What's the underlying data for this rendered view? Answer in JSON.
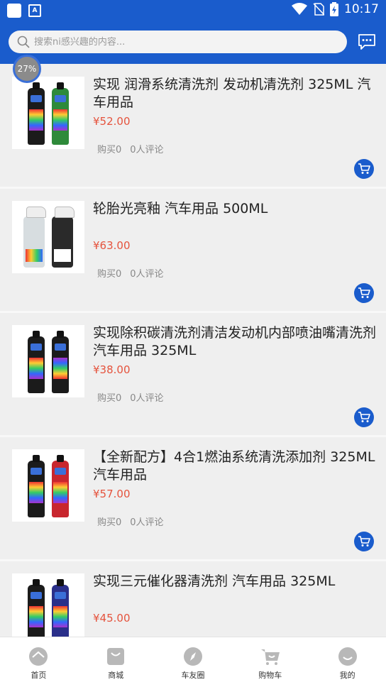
{
  "status_bar": {
    "time": "10:17"
  },
  "search": {
    "placeholder": "搜索ni感兴趣的内容..."
  },
  "progress": {
    "label": "27%",
    "value": 27
  },
  "products": [
    {
      "title": "实现 润滑系统清洗剂 发动机清洗剂 325ML 汽车用品",
      "price": "¥52.00",
      "sales": "购买0",
      "reviews": "0人评论",
      "image": "bottle-green"
    },
    {
      "title": "轮胎光亮釉 汽车用品 500ML",
      "price": "¥63.00",
      "sales": "购买0",
      "reviews": "0人评论",
      "image": "spray-pair"
    },
    {
      "title": "实现除积碳清洗剂清洁发动机内部喷油嘴清洗剂  汽车用品 325ML",
      "price": "¥38.00",
      "sales": "购买0",
      "reviews": "0人评论",
      "image": "bottle-rainbow"
    },
    {
      "title": "【全新配方】4合1燃油系统清洗添加剂 325ML 汽车用品",
      "price": "¥57.00",
      "sales": "购买0",
      "reviews": "0人评论",
      "image": "bottle-red"
    },
    {
      "title": "实现三元催化器清洗剂   汽车用品 325ML",
      "price": "¥45.00",
      "sales": "",
      "reviews": "",
      "image": "bottle-purple"
    }
  ],
  "tabs": [
    {
      "label": "首页",
      "icon": "home-icon"
    },
    {
      "label": "商城",
      "icon": "shop-bag-icon"
    },
    {
      "label": "车友圈",
      "icon": "compass-icon"
    },
    {
      "label": "购物车",
      "icon": "cart-icon"
    },
    {
      "label": "我的",
      "icon": "smiley-face-icon"
    }
  ],
  "colors": {
    "brand": "#1a5ccc",
    "price": "#e5533d",
    "tab_icon": "#b8b8b8"
  }
}
